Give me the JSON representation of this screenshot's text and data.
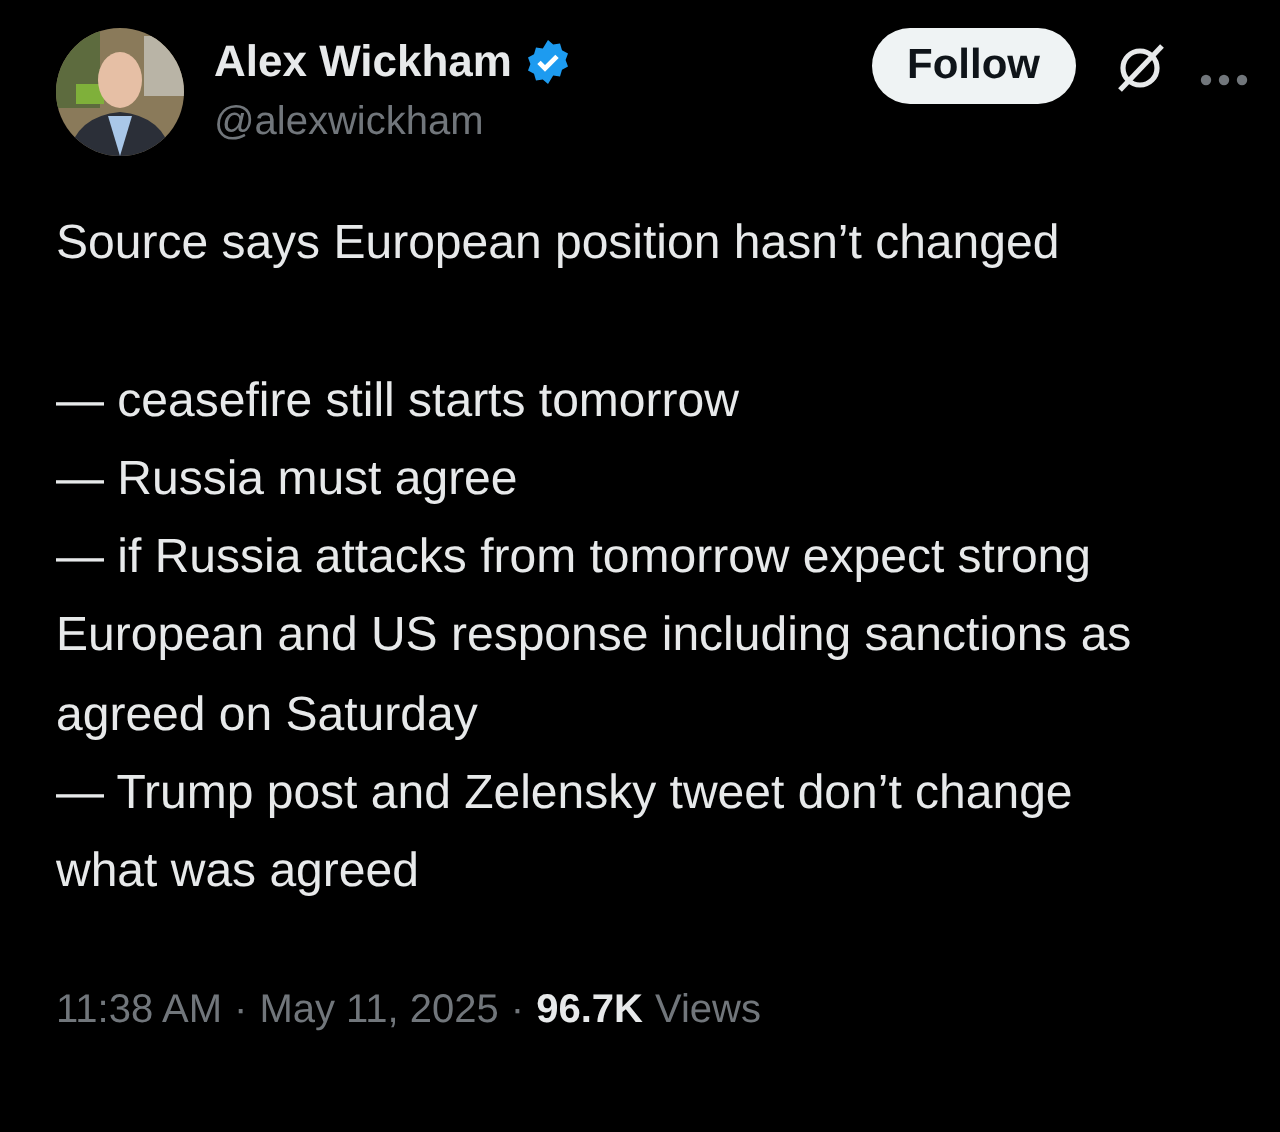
{
  "author": {
    "name": "Alex Wickham",
    "verified": true,
    "handle": "@alexwickham"
  },
  "follow_button": "Follow",
  "intro": "Source says European position hasn’t changed",
  "points": [
    "— ceasefire still starts tomorrow",
    "— Russia must agree",
    "— if Russia attacks from tomorrow expect strong European and US response including sanctions as agreed on Saturday",
    "— Trump post and Zelensky tweet don’t change what was agreed"
  ],
  "meta": {
    "time": "11:38 AM",
    "separator_1": "·",
    "date": "May 11, 2025",
    "separator_2": "·",
    "views_count": "96.7K",
    "views_label": "Views"
  }
}
